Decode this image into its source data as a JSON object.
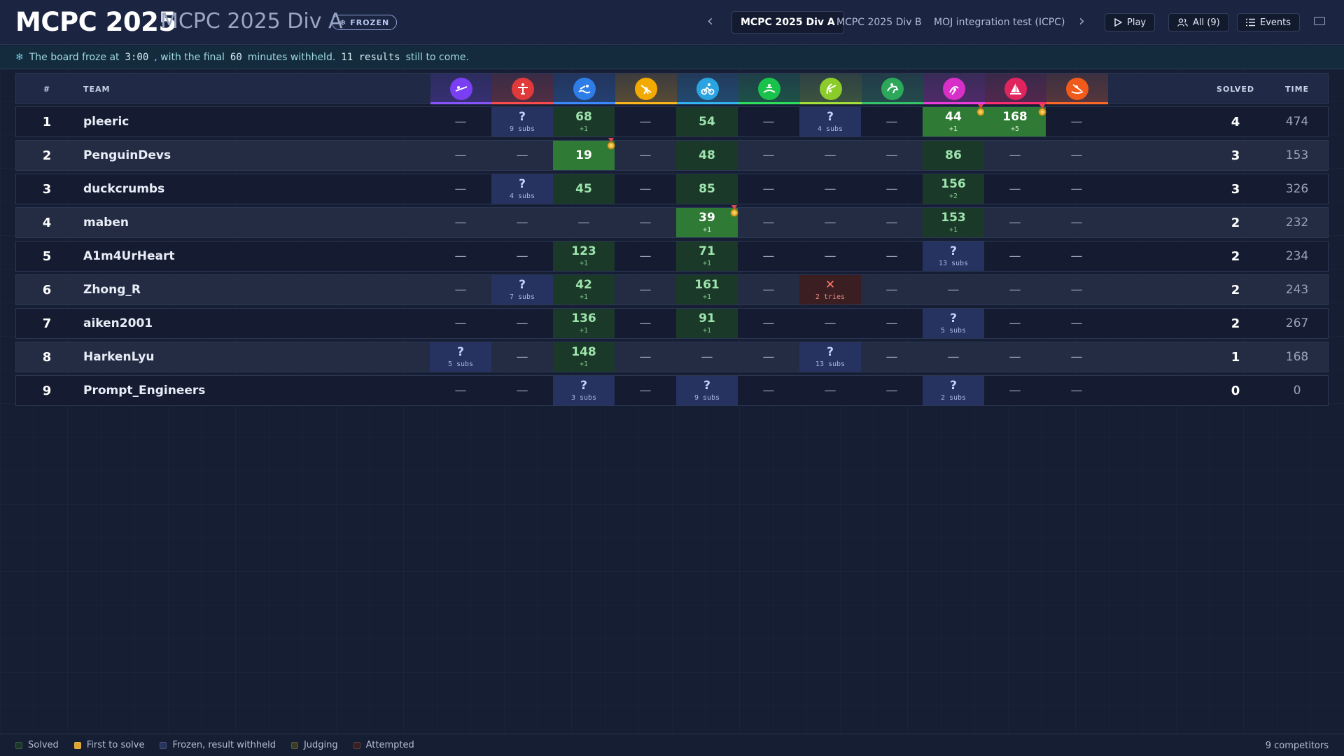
{
  "header": {
    "title": "MCPC 2025",
    "subtitle": "MCPC 2025 Div A",
    "badge": "FROZEN",
    "tabs": [
      "MCPC 2025 Div A",
      "MCPC 2025 Div B",
      "MOJ integration test (ICPC)"
    ],
    "play_label": "Play",
    "filter_label": "All (9)",
    "events_label": "Events"
  },
  "info": {
    "prefix": "The board froze at",
    "freeze_time": "3:00",
    "middle": ", with the final",
    "minutes": "60",
    "middle2": "minutes withheld.",
    "results": "11 results",
    "suffix": "still to come."
  },
  "table": {
    "rank_header": "#",
    "team_header": "TEAM",
    "solved_header": "SOLVED",
    "time_header": "TIME"
  },
  "problems": [
    {
      "icon": "fencing-icon",
      "color": "#7a3ff2",
      "bar": "#8a55ff"
    },
    {
      "icon": "gymnastics-icon",
      "color": "#e03a3a",
      "bar": "#ff4d4d"
    },
    {
      "icon": "swimming-icon",
      "color": "#2f7ee8",
      "bar": "#3d8cff"
    },
    {
      "icon": "weightlifting-icon",
      "color": "#f2a900",
      "bar": "#ffb81c"
    },
    {
      "icon": "cycling-icon",
      "color": "#2aa4e0",
      "bar": "#35b6f5"
    },
    {
      "icon": "rowing-icon",
      "color": "#19c24a",
      "bar": "#2ee05e"
    },
    {
      "icon": "archery-icon",
      "color": "#8ccc2a",
      "bar": "#a6e23a"
    },
    {
      "icon": "equestrian-icon",
      "color": "#2da85a",
      "bar": "#36c56b"
    },
    {
      "icon": "rhythmic-gymnastics-icon",
      "color": "#d82fc8",
      "bar": "#f03ddf"
    },
    {
      "icon": "sailing-icon",
      "color": "#e0245e",
      "bar": "#ff2e72"
    },
    {
      "icon": "canoe-icon",
      "color": "#f05a1a",
      "bar": "#ff6a28"
    }
  ],
  "rows": [
    {
      "rank": "1",
      "team": "pleeric",
      "solved": "4",
      "time": "474",
      "cells": [
        {
          "t": "empty",
          "v": "—"
        },
        {
          "t": "frozen",
          "v": "?",
          "s": "9 subs"
        },
        {
          "t": "solved",
          "v": "68",
          "s": "+1"
        },
        {
          "t": "empty",
          "v": "—"
        },
        {
          "t": "solved",
          "v": "54"
        },
        {
          "t": "empty",
          "v": "—"
        },
        {
          "t": "frozen",
          "v": "?",
          "s": "4 subs"
        },
        {
          "t": "empty",
          "v": "—"
        },
        {
          "t": "first",
          "v": "44",
          "s": "+1",
          "medal": true
        },
        {
          "t": "first",
          "v": "168",
          "s": "+5",
          "medal": true
        },
        {
          "t": "empty",
          "v": "—"
        }
      ]
    },
    {
      "rank": "2",
      "team": "PenguinDevs",
      "solved": "3",
      "time": "153",
      "cells": [
        {
          "t": "empty",
          "v": "—"
        },
        {
          "t": "empty",
          "v": "—"
        },
        {
          "t": "first",
          "v": "19",
          "medal": true
        },
        {
          "t": "empty",
          "v": "—"
        },
        {
          "t": "solved",
          "v": "48"
        },
        {
          "t": "empty",
          "v": "—"
        },
        {
          "t": "empty",
          "v": "—"
        },
        {
          "t": "empty",
          "v": "—"
        },
        {
          "t": "solved",
          "v": "86"
        },
        {
          "t": "empty",
          "v": "—"
        },
        {
          "t": "empty",
          "v": "—"
        }
      ]
    },
    {
      "rank": "3",
      "team": "duckcrumbs",
      "solved": "3",
      "time": "326",
      "cells": [
        {
          "t": "empty",
          "v": "—"
        },
        {
          "t": "frozen",
          "v": "?",
          "s": "4 subs"
        },
        {
          "t": "solved",
          "v": "45"
        },
        {
          "t": "empty",
          "v": "—"
        },
        {
          "t": "solved",
          "v": "85"
        },
        {
          "t": "empty",
          "v": "—"
        },
        {
          "t": "empty",
          "v": "—"
        },
        {
          "t": "empty",
          "v": "—"
        },
        {
          "t": "solved",
          "v": "156",
          "s": "+2"
        },
        {
          "t": "empty",
          "v": "—"
        },
        {
          "t": "empty",
          "v": "—"
        }
      ]
    },
    {
      "rank": "4",
      "team": "maben",
      "solved": "2",
      "time": "232",
      "cells": [
        {
          "t": "empty",
          "v": "—"
        },
        {
          "t": "empty",
          "v": "—"
        },
        {
          "t": "empty",
          "v": "—"
        },
        {
          "t": "empty",
          "v": "—"
        },
        {
          "t": "first",
          "v": "39",
          "s": "+1",
          "medal": true
        },
        {
          "t": "empty",
          "v": "—"
        },
        {
          "t": "empty",
          "v": "—"
        },
        {
          "t": "empty",
          "v": "—"
        },
        {
          "t": "solved",
          "v": "153",
          "s": "+1"
        },
        {
          "t": "empty",
          "v": "—"
        },
        {
          "t": "empty",
          "v": "—"
        }
      ]
    },
    {
      "rank": "5",
      "team": "A1m4UrHeart",
      "solved": "2",
      "time": "234",
      "cells": [
        {
          "t": "empty",
          "v": "—"
        },
        {
          "t": "empty",
          "v": "—"
        },
        {
          "t": "solved",
          "v": "123",
          "s": "+1"
        },
        {
          "t": "empty",
          "v": "—"
        },
        {
          "t": "solved",
          "v": "71",
          "s": "+1"
        },
        {
          "t": "empty",
          "v": "—"
        },
        {
          "t": "empty",
          "v": "—"
        },
        {
          "t": "empty",
          "v": "—"
        },
        {
          "t": "frozen",
          "v": "?",
          "s": "13 subs"
        },
        {
          "t": "empty",
          "v": "—"
        },
        {
          "t": "empty",
          "v": "—"
        }
      ]
    },
    {
      "rank": "6",
      "team": "Zhong_R",
      "solved": "2",
      "time": "243",
      "cells": [
        {
          "t": "empty",
          "v": "—"
        },
        {
          "t": "frozen",
          "v": "?",
          "s": "7 subs"
        },
        {
          "t": "solved",
          "v": "42",
          "s": "+1"
        },
        {
          "t": "empty",
          "v": "—"
        },
        {
          "t": "solved",
          "v": "161",
          "s": "+1"
        },
        {
          "t": "empty",
          "v": "—"
        },
        {
          "t": "attempt",
          "v": "✕",
          "s": "2 tries"
        },
        {
          "t": "empty",
          "v": "—"
        },
        {
          "t": "empty",
          "v": "—"
        },
        {
          "t": "empty",
          "v": "—"
        },
        {
          "t": "empty",
          "v": "—"
        }
      ]
    },
    {
      "rank": "7",
      "team": "aiken2001",
      "solved": "2",
      "time": "267",
      "cells": [
        {
          "t": "empty",
          "v": "—"
        },
        {
          "t": "empty",
          "v": "—"
        },
        {
          "t": "solved",
          "v": "136",
          "s": "+1"
        },
        {
          "t": "empty",
          "v": "—"
        },
        {
          "t": "solved",
          "v": "91",
          "s": "+1"
        },
        {
          "t": "empty",
          "v": "—"
        },
        {
          "t": "empty",
          "v": "—"
        },
        {
          "t": "empty",
          "v": "—"
        },
        {
          "t": "frozen",
          "v": "?",
          "s": "5 subs"
        },
        {
          "t": "empty",
          "v": "—"
        },
        {
          "t": "empty",
          "v": "—"
        }
      ]
    },
    {
      "rank": "8",
      "team": "HarkenLyu",
      "solved": "1",
      "time": "168",
      "cells": [
        {
          "t": "frozen",
          "v": "?",
          "s": "5 subs"
        },
        {
          "t": "empty",
          "v": "—"
        },
        {
          "t": "solved",
          "v": "148",
          "s": "+1"
        },
        {
          "t": "empty",
          "v": "—"
        },
        {
          "t": "empty",
          "v": "—"
        },
        {
          "t": "empty",
          "v": "—"
        },
        {
          "t": "frozen",
          "v": "?",
          "s": "13 subs"
        },
        {
          "t": "empty",
          "v": "—"
        },
        {
          "t": "empty",
          "v": "—"
        },
        {
          "t": "empty",
          "v": "—"
        },
        {
          "t": "empty",
          "v": "—"
        }
      ]
    },
    {
      "rank": "9",
      "team": "Prompt_Engineers",
      "solved": "0",
      "time": "0",
      "cells": [
        {
          "t": "empty",
          "v": "—"
        },
        {
          "t": "empty",
          "v": "—"
        },
        {
          "t": "frozen",
          "v": "?",
          "s": "3 subs"
        },
        {
          "t": "empty",
          "v": "—"
        },
        {
          "t": "frozen",
          "v": "?",
          "s": "9 subs"
        },
        {
          "t": "empty",
          "v": "—"
        },
        {
          "t": "empty",
          "v": "—"
        },
        {
          "t": "empty",
          "v": "—"
        },
        {
          "t": "frozen",
          "v": "?",
          "s": "2 subs"
        },
        {
          "t": "empty",
          "v": "—"
        },
        {
          "t": "empty",
          "v": "—"
        }
      ]
    }
  ],
  "legend": [
    {
      "label": "Solved",
      "color": "#1b3928"
    },
    {
      "label": "First to solve",
      "color": "#e0a52a"
    },
    {
      "label": "Frozen, result withheld",
      "color": "#263260"
    },
    {
      "label": "Judging",
      "color": "#3b3a22"
    },
    {
      "label": "Attempted",
      "color": "#3a1e22"
    }
  ],
  "footer": {
    "count": "9 competitors"
  }
}
